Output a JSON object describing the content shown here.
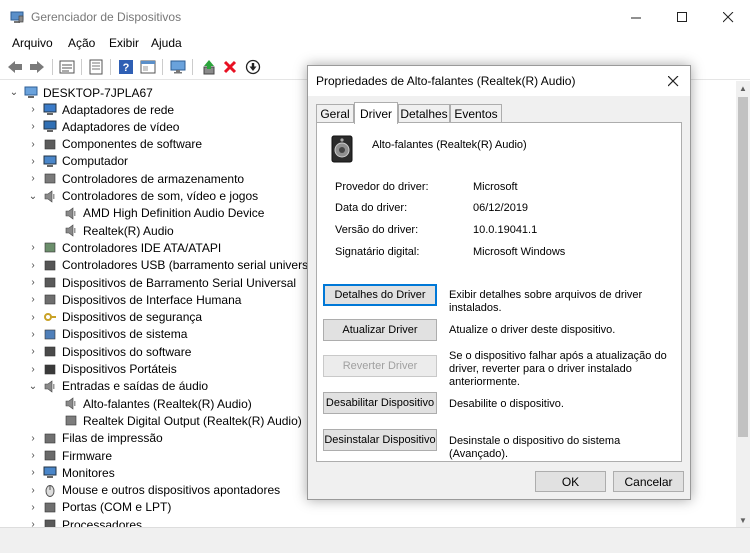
{
  "window": {
    "title": "Gerenciador de Dispositivos"
  },
  "menu": [
    "Arquivo",
    "Ação",
    "Exibir",
    "Ajuda"
  ],
  "toolbar": {
    "icons": [
      "back-arrow-icon",
      "forward-arrow-icon",
      "properties-icon",
      "list-icon",
      "help-icon",
      "view-icon",
      "monitor-icon",
      "update-driver-icon",
      "uninstall-icon",
      "scan-icon"
    ]
  },
  "tree": {
    "root": "DESKTOP-7JPLA67",
    "items": [
      {
        "label": "Adaptadores de rede",
        "icon": "network-adapter-icon",
        "state": "collapsed"
      },
      {
        "label": "Adaptadores de vídeo",
        "icon": "display-adapter-icon",
        "state": "collapsed"
      },
      {
        "label": "Componentes de software",
        "icon": "software-component-icon",
        "state": "collapsed"
      },
      {
        "label": "Computador",
        "icon": "computer-icon",
        "state": "collapsed"
      },
      {
        "label": "Controladores de armazenamento",
        "icon": "storage-controller-icon",
        "state": "collapsed"
      },
      {
        "label": "Controladores de som, vídeo e jogos",
        "icon": "speaker-icon",
        "state": "expanded"
      },
      {
        "label": "AMD High Definition Audio Device",
        "icon": "speaker-icon",
        "state": "child"
      },
      {
        "label": "Realtek(R) Audio",
        "icon": "speaker-icon",
        "state": "child"
      },
      {
        "label": "Controladores IDE ATA/ATAPI",
        "icon": "ide-controller-icon",
        "state": "collapsed"
      },
      {
        "label": "Controladores USB (barramento serial universal)",
        "icon": "usb-icon",
        "state": "collapsed"
      },
      {
        "label": "Dispositivos de Barramento Serial Universal",
        "icon": "usb-device-icon",
        "state": "collapsed"
      },
      {
        "label": "Dispositivos de Interface Humana",
        "icon": "hid-icon",
        "state": "collapsed"
      },
      {
        "label": "Dispositivos de segurança",
        "icon": "security-device-icon",
        "state": "collapsed"
      },
      {
        "label": "Dispositivos de sistema",
        "icon": "system-device-icon",
        "state": "collapsed"
      },
      {
        "label": "Dispositivos do software",
        "icon": "software-device-icon",
        "state": "collapsed"
      },
      {
        "label": "Dispositivos Portáteis",
        "icon": "portable-device-icon",
        "state": "collapsed"
      },
      {
        "label": "Entradas e saídas de áudio",
        "icon": "speaker-icon",
        "state": "expanded"
      },
      {
        "label": "Alto-falantes (Realtek(R) Audio)",
        "icon": "speaker-icon",
        "state": "child"
      },
      {
        "label": "Realtek Digital Output (Realtek(R) Audio)",
        "icon": "digital-output-icon",
        "state": "child"
      },
      {
        "label": "Filas de impressão",
        "icon": "printer-icon",
        "state": "collapsed"
      },
      {
        "label": "Firmware",
        "icon": "firmware-icon",
        "state": "collapsed"
      },
      {
        "label": "Monitores",
        "icon": "monitor-icon",
        "state": "collapsed"
      },
      {
        "label": "Mouse e outros dispositivos apontadores",
        "icon": "mouse-icon",
        "state": "collapsed"
      },
      {
        "label": "Portas (COM e LPT)",
        "icon": "port-icon",
        "state": "collapsed"
      },
      {
        "label": "Processadores",
        "icon": "processor-icon",
        "state": "collapsed"
      }
    ]
  },
  "dialog": {
    "title": "Propriedades de Alto-falantes (Realtek(R) Audio)",
    "tabs": [
      {
        "label": "Geral",
        "active": false
      },
      {
        "label": "Driver",
        "active": true
      },
      {
        "label": "Detalhes",
        "active": false
      },
      {
        "label": "Eventos",
        "active": false
      }
    ],
    "device_name": "Alto-falantes (Realtek(R) Audio)",
    "properties": [
      {
        "label": "Provedor do driver:",
        "value": "Microsoft"
      },
      {
        "label": "Data do driver:",
        "value": "06/12/2019"
      },
      {
        "label": "Versão do driver:",
        "value": "10.0.19041.1"
      },
      {
        "label": "Signatário digital:",
        "value": "Microsoft Windows"
      }
    ],
    "actions": [
      {
        "label": "Detalhes do Driver",
        "desc": "Exibir detalhes sobre arquivos de driver instalados.",
        "enabled": true,
        "default": true
      },
      {
        "label": "Atualizar Driver",
        "desc": "Atualize o driver deste dispositivo.",
        "enabled": true,
        "default": false
      },
      {
        "label": "Reverter Driver",
        "desc": "Se o dispositivo falhar após a atualização do driver, reverter para o driver instalado anteriormente.",
        "enabled": false,
        "default": false
      },
      {
        "label": "Desabilitar Dispositivo",
        "desc": "Desabilite o dispositivo.",
        "enabled": true,
        "default": false
      },
      {
        "label": "Desinstalar Dispositivo",
        "desc": "Desinstale o dispositivo do sistema (Avançado).",
        "enabled": true,
        "default": false
      }
    ],
    "ok_label": "OK",
    "cancel_label": "Cancelar"
  },
  "colors": {
    "accent": "#0078d7",
    "dialog_bg": "#f0f0f0",
    "error_red": "#e81123",
    "green": "#2ba43c"
  }
}
